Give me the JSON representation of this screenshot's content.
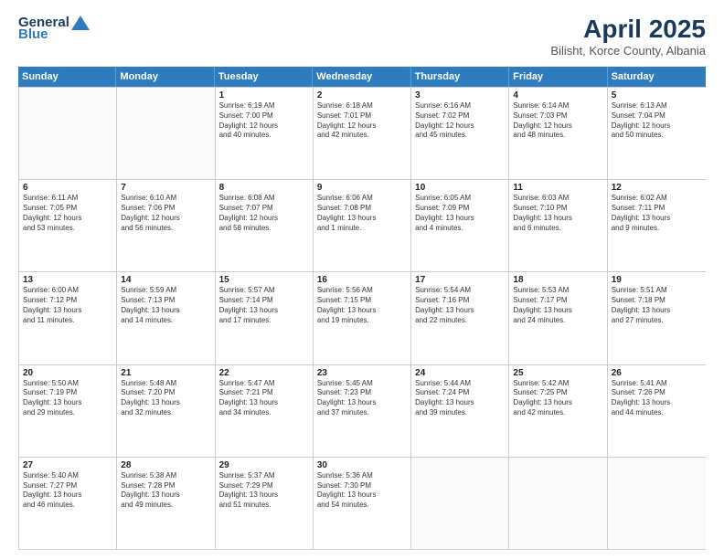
{
  "logo": {
    "general": "General",
    "blue": "Blue"
  },
  "title": "April 2025",
  "location": "Bilisht, Korce County, Albania",
  "days": [
    "Sunday",
    "Monday",
    "Tuesday",
    "Wednesday",
    "Thursday",
    "Friday",
    "Saturday"
  ],
  "weeks": [
    [
      {
        "day": "",
        "content": ""
      },
      {
        "day": "",
        "content": ""
      },
      {
        "day": "1",
        "content": "Sunrise: 6:19 AM\nSunset: 7:00 PM\nDaylight: 12 hours\nand 40 minutes."
      },
      {
        "day": "2",
        "content": "Sunrise: 6:18 AM\nSunset: 7:01 PM\nDaylight: 12 hours\nand 42 minutes."
      },
      {
        "day": "3",
        "content": "Sunrise: 6:16 AM\nSunset: 7:02 PM\nDaylight: 12 hours\nand 45 minutes."
      },
      {
        "day": "4",
        "content": "Sunrise: 6:14 AM\nSunset: 7:03 PM\nDaylight: 12 hours\nand 48 minutes."
      },
      {
        "day": "5",
        "content": "Sunrise: 6:13 AM\nSunset: 7:04 PM\nDaylight: 12 hours\nand 50 minutes."
      }
    ],
    [
      {
        "day": "6",
        "content": "Sunrise: 6:11 AM\nSunset: 7:05 PM\nDaylight: 12 hours\nand 53 minutes."
      },
      {
        "day": "7",
        "content": "Sunrise: 6:10 AM\nSunset: 7:06 PM\nDaylight: 12 hours\nand 56 minutes."
      },
      {
        "day": "8",
        "content": "Sunrise: 6:08 AM\nSunset: 7:07 PM\nDaylight: 12 hours\nand 58 minutes."
      },
      {
        "day": "9",
        "content": "Sunrise: 6:06 AM\nSunset: 7:08 PM\nDaylight: 13 hours\nand 1 minute."
      },
      {
        "day": "10",
        "content": "Sunrise: 6:05 AM\nSunset: 7:09 PM\nDaylight: 13 hours\nand 4 minutes."
      },
      {
        "day": "11",
        "content": "Sunrise: 6:03 AM\nSunset: 7:10 PM\nDaylight: 13 hours\nand 6 minutes."
      },
      {
        "day": "12",
        "content": "Sunrise: 6:02 AM\nSunset: 7:11 PM\nDaylight: 13 hours\nand 9 minutes."
      }
    ],
    [
      {
        "day": "13",
        "content": "Sunrise: 6:00 AM\nSunset: 7:12 PM\nDaylight: 13 hours\nand 11 minutes."
      },
      {
        "day": "14",
        "content": "Sunrise: 5:59 AM\nSunset: 7:13 PM\nDaylight: 13 hours\nand 14 minutes."
      },
      {
        "day": "15",
        "content": "Sunrise: 5:57 AM\nSunset: 7:14 PM\nDaylight: 13 hours\nand 17 minutes."
      },
      {
        "day": "16",
        "content": "Sunrise: 5:56 AM\nSunset: 7:15 PM\nDaylight: 13 hours\nand 19 minutes."
      },
      {
        "day": "17",
        "content": "Sunrise: 5:54 AM\nSunset: 7:16 PM\nDaylight: 13 hours\nand 22 minutes."
      },
      {
        "day": "18",
        "content": "Sunrise: 5:53 AM\nSunset: 7:17 PM\nDaylight: 13 hours\nand 24 minutes."
      },
      {
        "day": "19",
        "content": "Sunrise: 5:51 AM\nSunset: 7:18 PM\nDaylight: 13 hours\nand 27 minutes."
      }
    ],
    [
      {
        "day": "20",
        "content": "Sunrise: 5:50 AM\nSunset: 7:19 PM\nDaylight: 13 hours\nand 29 minutes."
      },
      {
        "day": "21",
        "content": "Sunrise: 5:48 AM\nSunset: 7:20 PM\nDaylight: 13 hours\nand 32 minutes."
      },
      {
        "day": "22",
        "content": "Sunrise: 5:47 AM\nSunset: 7:21 PM\nDaylight: 13 hours\nand 34 minutes."
      },
      {
        "day": "23",
        "content": "Sunrise: 5:45 AM\nSunset: 7:23 PM\nDaylight: 13 hours\nand 37 minutes."
      },
      {
        "day": "24",
        "content": "Sunrise: 5:44 AM\nSunset: 7:24 PM\nDaylight: 13 hours\nand 39 minutes."
      },
      {
        "day": "25",
        "content": "Sunrise: 5:42 AM\nSunset: 7:25 PM\nDaylight: 13 hours\nand 42 minutes."
      },
      {
        "day": "26",
        "content": "Sunrise: 5:41 AM\nSunset: 7:26 PM\nDaylight: 13 hours\nand 44 minutes."
      }
    ],
    [
      {
        "day": "27",
        "content": "Sunrise: 5:40 AM\nSunset: 7:27 PM\nDaylight: 13 hours\nand 46 minutes."
      },
      {
        "day": "28",
        "content": "Sunrise: 5:38 AM\nSunset: 7:28 PM\nDaylight: 13 hours\nand 49 minutes."
      },
      {
        "day": "29",
        "content": "Sunrise: 5:37 AM\nSunset: 7:29 PM\nDaylight: 13 hours\nand 51 minutes."
      },
      {
        "day": "30",
        "content": "Sunrise: 5:36 AM\nSunset: 7:30 PM\nDaylight: 13 hours\nand 54 minutes."
      },
      {
        "day": "",
        "content": ""
      },
      {
        "day": "",
        "content": ""
      },
      {
        "day": "",
        "content": ""
      }
    ]
  ]
}
